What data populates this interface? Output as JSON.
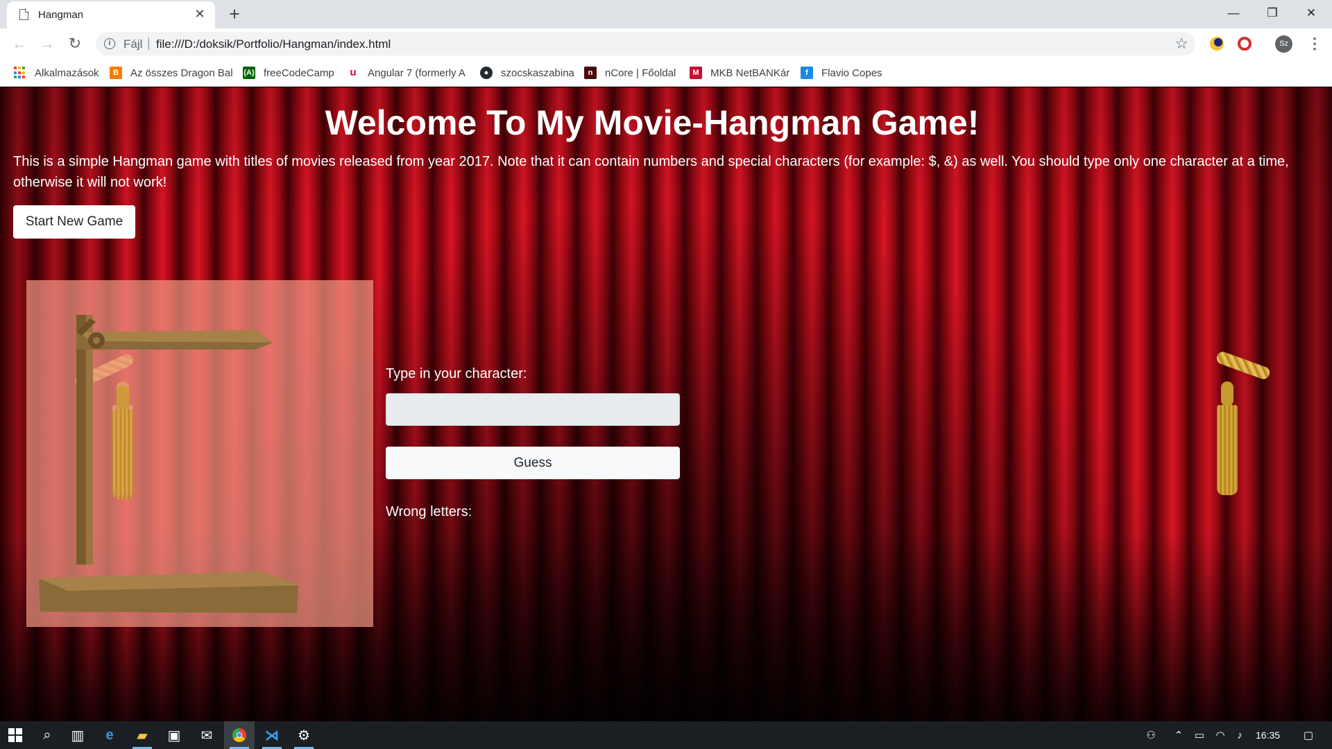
{
  "browser": {
    "tab": {
      "title": "Hangman",
      "close_glyph": "✕"
    },
    "new_tab_glyph": "+",
    "window_controls": {
      "minimize": "—",
      "maximize": "❐",
      "close": "✕"
    },
    "toolbar": {
      "back_glyph": "←",
      "forward_glyph": "→",
      "reload_glyph": "↻",
      "scheme_label": "Fájl",
      "url": "file:///D:/doksik/Portfolio/Hangman/index.html",
      "star_glyph": "☆",
      "profile_initials": "Sz",
      "menu_glyph": "⋮"
    },
    "bookmarks": [
      {
        "label": "Alkalmazások",
        "icon": "apps-grid-icon"
      },
      {
        "label": "Az összes Dragon Bal",
        "icon": "blogger-icon",
        "color": "#f57c00"
      },
      {
        "label": "freeCodeCamp",
        "icon": "freecodecamp-icon",
        "color": "#006400"
      },
      {
        "label": "Angular 7 (formerly A",
        "icon": "angular-icon",
        "color": "#dd0031"
      },
      {
        "label": "szocskaszabina",
        "icon": "github-icon",
        "color": "#24292e"
      },
      {
        "label": "nCore | Főoldal",
        "icon": "ncore-icon",
        "color": "#4a0a0a"
      },
      {
        "label": "MKB NetBANKár",
        "icon": "mkb-icon",
        "color": "#c8102e"
      },
      {
        "label": "Flavio Copes",
        "icon": "flavio-icon",
        "color": "#1e88e5"
      }
    ]
  },
  "page": {
    "title": "Welcome To My Movie-Hangman Game!",
    "description": "This is a simple Hangman game with titles of movies released from year 2017. Note that it can contain numbers and special characters (for example: $, &) as well. You should type only one character at a time, otherwise it will not work!",
    "start_button": "Start New Game",
    "input_label": "Type in your character:",
    "input_value": "",
    "guess_button": "Guess",
    "wrong_letters_label": "Wrong letters:",
    "wrong_letters": "",
    "colors": {
      "curtain_red": "#d81424",
      "gallows_box": "#f09682",
      "wood": "#8b6a3a"
    }
  },
  "taskbar": {
    "icons": [
      "windows-start-icon",
      "search-icon",
      "task-view-icon",
      "edge-icon",
      "file-explorer-icon",
      "store-icon",
      "mail-icon",
      "chrome-icon",
      "vscode-icon",
      "app-icon"
    ],
    "tray": [
      "people-icon",
      "chevron-up-icon",
      "battery-icon",
      "wifi-icon",
      "volume-icon"
    ],
    "time": "16:35",
    "notification_icon": "action-center-icon"
  }
}
